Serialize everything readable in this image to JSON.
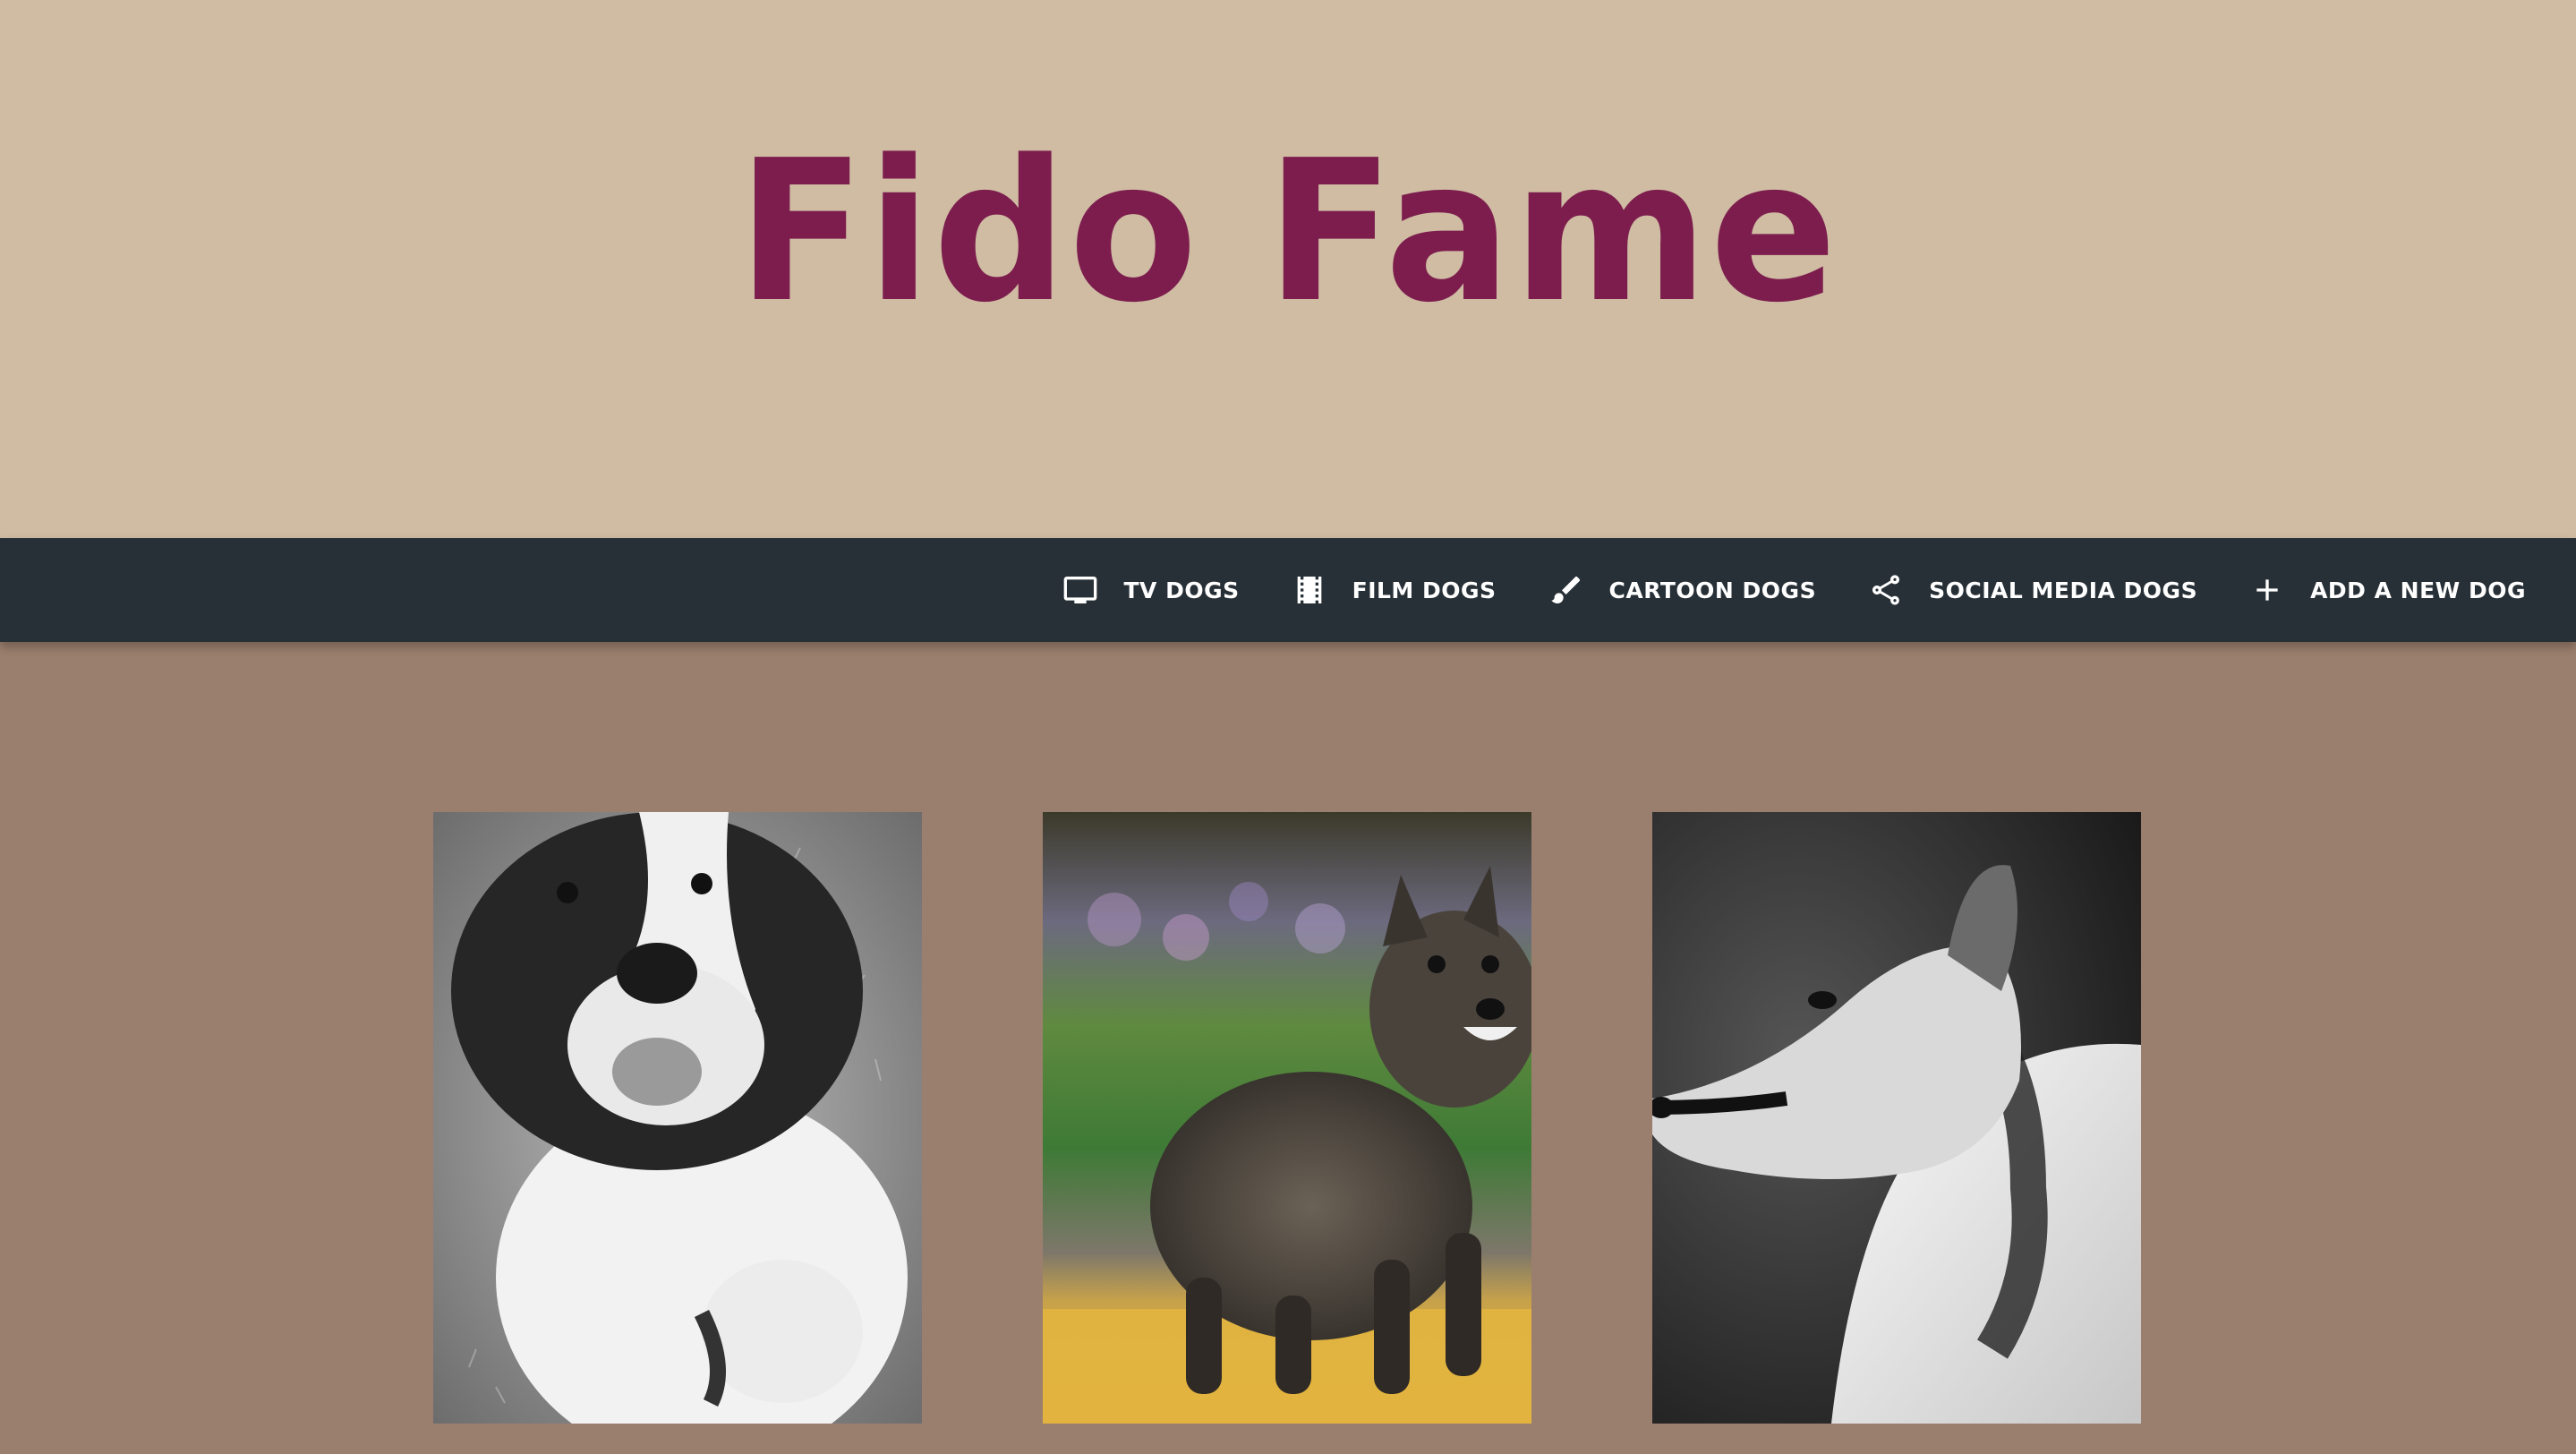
{
  "site": {
    "title": "Fido Fame"
  },
  "nav": {
    "items": [
      {
        "label": "TV DOGS",
        "icon": "tv-icon"
      },
      {
        "label": "FILM DOGS",
        "icon": "film-icon"
      },
      {
        "label": "CARTOON DOGS",
        "icon": "brush-icon"
      },
      {
        "label": "SOCIAL MEDIA DOGS",
        "icon": "share-icon"
      },
      {
        "label": "ADD A NEW DOG",
        "icon": "plus-icon"
      }
    ]
  },
  "gallery": {
    "photos": [
      {
        "subject": "saint-bernard",
        "tone": "grayscale"
      },
      {
        "subject": "cairn-terrier",
        "tone": "color"
      },
      {
        "subject": "rough-collie",
        "tone": "grayscale"
      }
    ]
  },
  "colors": {
    "header_bg": "#cfbca2",
    "title": "#7c1d4e",
    "navbar_bg": "#283037",
    "page_bg": "#9b7f6e",
    "nav_text": "#ffffff"
  }
}
